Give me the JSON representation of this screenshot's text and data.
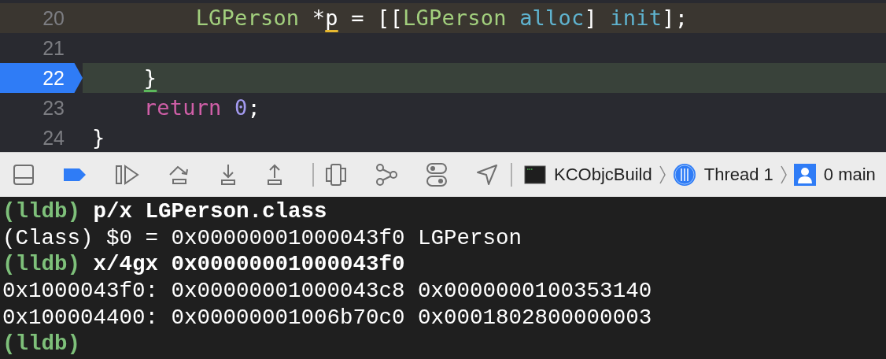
{
  "editor": {
    "lines": [
      {
        "number": "20",
        "warning": true,
        "current": false,
        "tokens": [
          {
            "kind": "type",
            "text": "        LGPerson",
            "underlined": false
          },
          {
            "kind": "plain",
            "text": " *",
            "underlined": false
          },
          {
            "kind": "plain",
            "text": "p",
            "underlined": true
          },
          {
            "kind": "plain",
            "text": " = [[",
            "underlined": false
          },
          {
            "kind": "type",
            "text": "LGPerson",
            "underlined": false
          },
          {
            "kind": "method",
            "text": " alloc",
            "underlined": false
          },
          {
            "kind": "plain",
            "text": "] ",
            "underlined": false
          },
          {
            "kind": "method",
            "text": "init",
            "underlined": false
          },
          {
            "kind": "plain",
            "text": "];",
            "underlined": false
          }
        ]
      },
      {
        "number": "21",
        "warning": false,
        "current": false
      },
      {
        "number": "22",
        "warning": false,
        "current": true,
        "tokens": [
          {
            "kind": "plain",
            "text": "    }",
            "underlined": true
          }
        ]
      },
      {
        "number": "23",
        "warning": false,
        "current": false,
        "tokens": [
          {
            "kind": "keyword",
            "text": "    return",
            "underlined": false
          },
          {
            "kind": "number",
            "text": " 0",
            "underlined": false
          },
          {
            "kind": "plain",
            "text": ";",
            "underlined": false
          }
        ]
      },
      {
        "number": "24",
        "warning": false,
        "current": false,
        "tokens": [
          {
            "kind": "plain",
            "text": "}",
            "underlined": false
          }
        ]
      }
    ]
  },
  "debug_bar": {
    "breakpoints_active": true,
    "breadcrumbs": [
      {
        "kind": "process",
        "label": "KCObjcBuild"
      },
      {
        "kind": "thread",
        "label": "Thread 1"
      },
      {
        "kind": "frame",
        "label": "0 main"
      }
    ]
  },
  "console": {
    "lines": [
      {
        "kind": "command",
        "prompt": "(lldb)",
        "text": "p/x LGPerson.class"
      },
      {
        "kind": "output",
        "text": "(Class) $0 = 0x00000001000043f0 LGPerson"
      },
      {
        "kind": "command",
        "prompt": "(lldb)",
        "text": "x/4gx 0x00000001000043f0"
      },
      {
        "kind": "output",
        "text": "0x1000043f0: 0x00000001000043c8 0x0000000100353140"
      },
      {
        "kind": "output",
        "text": "0x100004400: 0x00000001006b70c0 0x0001802800000003"
      },
      {
        "kind": "command",
        "prompt": "(lldb)"
      }
    ]
  }
}
